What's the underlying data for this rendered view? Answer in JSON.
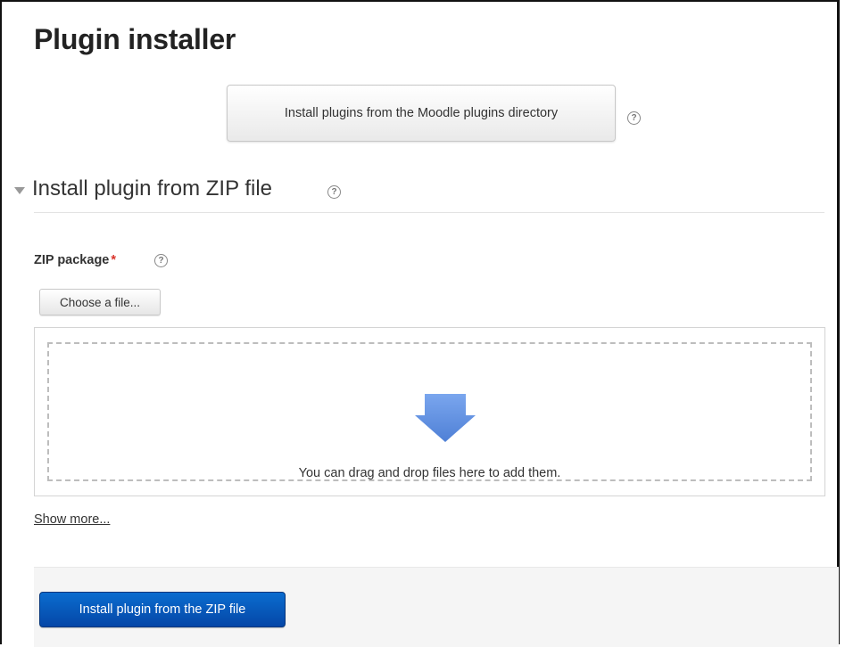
{
  "page": {
    "title": "Plugin installer"
  },
  "directory": {
    "button_label": "Install plugins from the Moodle plugins directory",
    "help_icon": "help-icon"
  },
  "section": {
    "title": "Install plugin from ZIP file",
    "collapse_icon": "triangle-down-icon",
    "help_icon": "help-icon"
  },
  "zip_field": {
    "label": "ZIP package",
    "required_marker": "*",
    "help_icon": "help-icon",
    "choose_button_label": "Choose a file...",
    "dropzone_text": "You can drag and drop files here to add them.",
    "dropzone_icon": "download-arrow-icon"
  },
  "show_more": {
    "label": "Show more..."
  },
  "submit": {
    "label": "Install plugin from the ZIP file"
  },
  "colors": {
    "primary_button": "#0a6ccf",
    "required_star": "#d9342b",
    "drop_arrow": "#5b8fe0"
  }
}
